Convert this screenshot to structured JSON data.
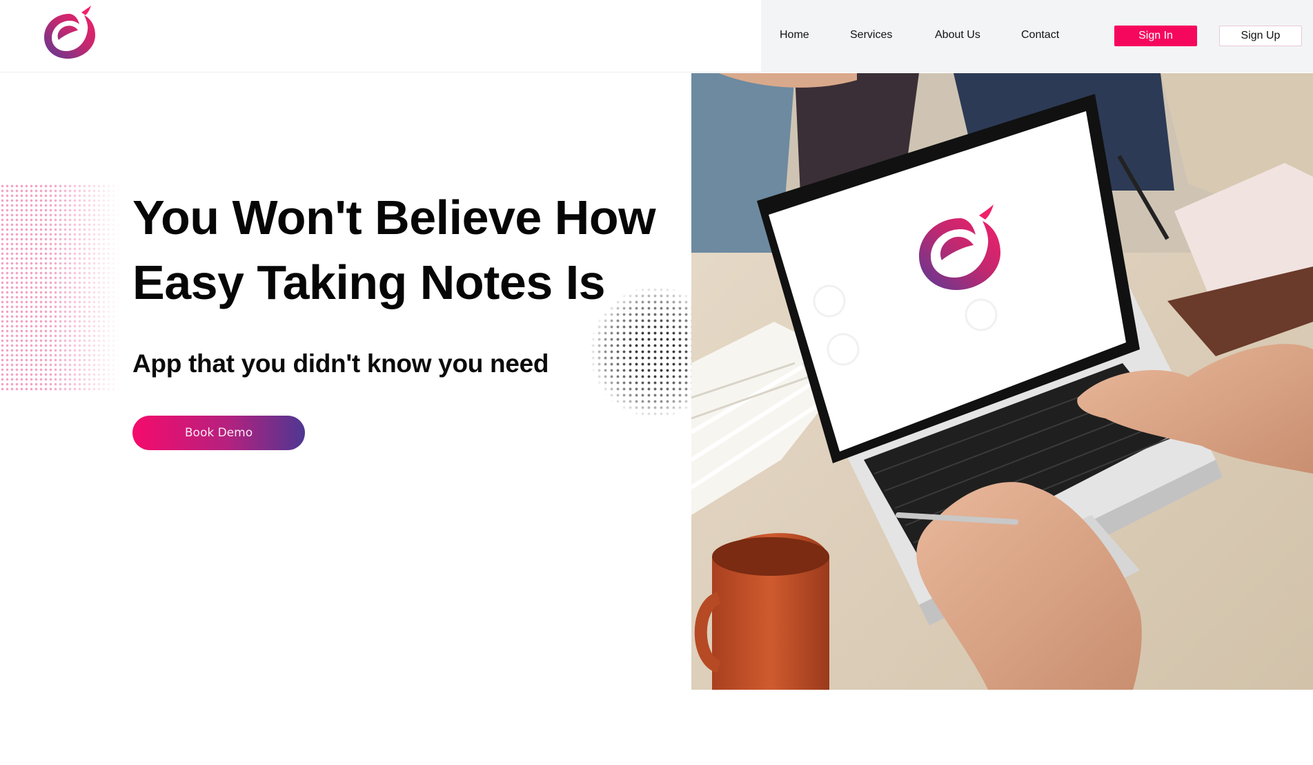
{
  "brand": {
    "logo_icon": "brand-swirl-logo",
    "colors": {
      "primary": "#f6075e",
      "gradient_start": "#f50b6c",
      "gradient_end": "#4e3792",
      "nav_bg": "#f3f4f6"
    }
  },
  "nav": {
    "links": [
      {
        "label": "Home"
      },
      {
        "label": "Services"
      },
      {
        "label": "About Us"
      },
      {
        "label": "Contact"
      }
    ],
    "sign_in_label": "Sign In",
    "sign_up_label": "Sign Up"
  },
  "hero": {
    "title_line_1": "You Won't Believe How",
    "title_line_2": "Easy Taking Notes Is",
    "subtitle": "App that you didn't know you need",
    "cta_label": "Book Demo"
  },
  "photo": {
    "subject": "laptop-on-desk-photo"
  }
}
